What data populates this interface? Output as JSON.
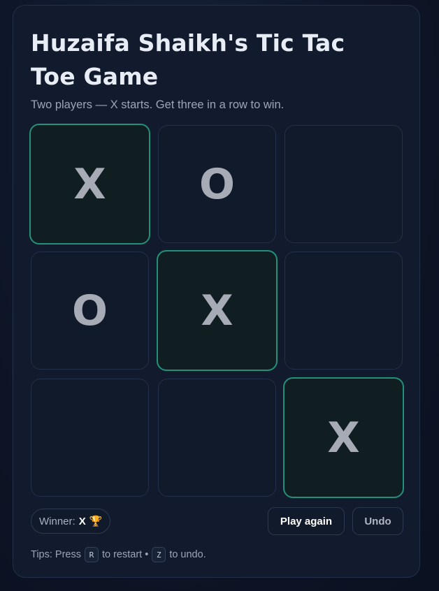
{
  "title": "Huzaifa Shaikh's Tic Tac Toe Game",
  "subtitle": "Two players — X starts. Get three in a row to win.",
  "board": {
    "cells": [
      "X",
      "O",
      "",
      "O",
      "X",
      "",
      "",
      "",
      "X"
    ],
    "winning_cells": [
      0,
      4,
      8
    ]
  },
  "status": {
    "label": "Winner:",
    "winner": "X",
    "trophy": "🏆"
  },
  "buttons": {
    "play_again": "Play again",
    "undo": "Undo"
  },
  "tips": {
    "prefix": "Tips: Press",
    "restart_key": "R",
    "restart_text": "to restart •",
    "undo_key": "Z",
    "undo_text": "to undo."
  },
  "colors": {
    "win_border": "#23917a",
    "mark": "#a6abb6"
  }
}
